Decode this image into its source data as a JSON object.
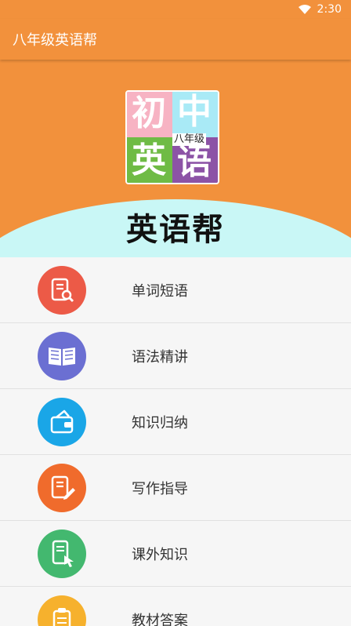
{
  "status": {
    "time": "2:30"
  },
  "app": {
    "title": "八年级英语帮"
  },
  "hero": {
    "logo": {
      "tl": "初",
      "tr": "中",
      "bl": "英",
      "br": "语",
      "sub": "八年级"
    },
    "title": "英语帮"
  },
  "menu": {
    "items": [
      {
        "label": "单词短语",
        "icon": "document-search-icon",
        "color": "#ec5a47"
      },
      {
        "label": "语法精讲",
        "icon": "open-book-icon",
        "color": "#6b6fd2"
      },
      {
        "label": "知识归纳",
        "icon": "wallet-icon",
        "color": "#1aa6e7"
      },
      {
        "label": "写作指导",
        "icon": "document-pen-icon",
        "color": "#f06b2c"
      },
      {
        "label": "课外知识",
        "icon": "mobile-touch-icon",
        "color": "#43b86f"
      },
      {
        "label": "教材答案",
        "icon": "answer-sheet-icon",
        "color": "#f6b12d"
      }
    ]
  }
}
